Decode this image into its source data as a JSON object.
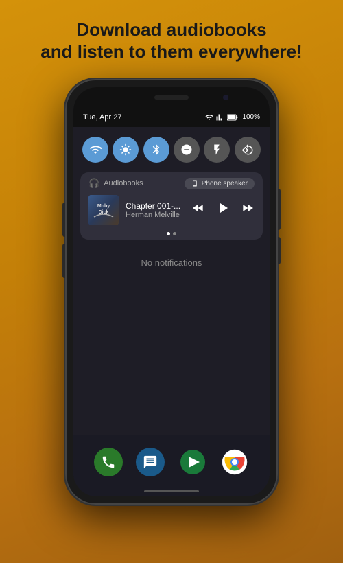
{
  "headline": {
    "line1": "Download audiobooks",
    "line2": "and listen to them everywhere!"
  },
  "phone": {
    "status_bar": {
      "time": "Tue, Apr 27",
      "battery": "100%"
    },
    "quick_toggles": [
      {
        "id": "wifi",
        "active": true,
        "icon": "wifi"
      },
      {
        "id": "brightness",
        "active": true,
        "icon": "brightness"
      },
      {
        "id": "bluetooth",
        "active": true,
        "icon": "bluetooth"
      },
      {
        "id": "dnd",
        "active": false,
        "icon": "dnd"
      },
      {
        "id": "flashlight",
        "active": false,
        "icon": "flashlight"
      },
      {
        "id": "rotate",
        "active": false,
        "icon": "rotate"
      }
    ],
    "media_notification": {
      "app_name": "Audiobooks",
      "output_device": "Phone speaker",
      "track_title": "Chapter 001-...",
      "track_artist": "Herman Melville",
      "album_title": "Moby Dick"
    },
    "no_notifications_text": "No notifications",
    "dock_apps": [
      {
        "id": "phone",
        "label": "Phone"
      },
      {
        "id": "messages",
        "label": "Messages"
      },
      {
        "id": "play",
        "label": "Play Store"
      },
      {
        "id": "chrome",
        "label": "Chrome"
      }
    ]
  }
}
